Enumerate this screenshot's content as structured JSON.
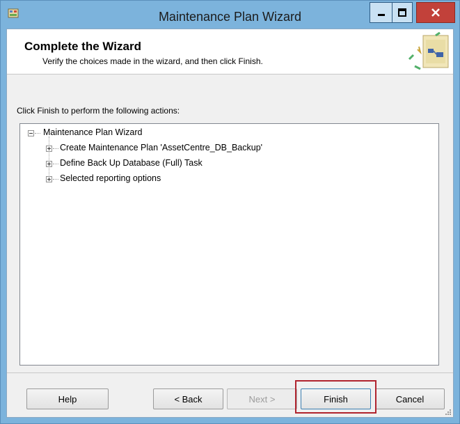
{
  "window": {
    "title": "Maintenance Plan Wizard",
    "icon": "wizard-app-icon",
    "controls": [
      "minimize-icon",
      "maximize-icon",
      "close-icon"
    ]
  },
  "header": {
    "title": "Complete the Wizard",
    "subtitle": "Verify the choices made in the wizard, and then click Finish.",
    "graphic": "wizard-graphic-icon"
  },
  "main": {
    "prompt": "Click Finish to perform the following actions:",
    "tree": {
      "root": {
        "label": "Maintenance Plan Wizard",
        "expanded": true
      },
      "children": [
        {
          "label": "Create Maintenance Plan 'AssetCentre_DB_Backup'",
          "expanded": false
        },
        {
          "label": "Define Back Up Database (Full) Task",
          "expanded": false
        },
        {
          "label": "Selected reporting options",
          "expanded": false
        }
      ]
    }
  },
  "buttons": {
    "help": "Help",
    "back": "< Back",
    "next": "Next >",
    "finish": "Finish",
    "cancel": "Cancel"
  },
  "colors": {
    "titlebar": "#7cb3dc",
    "close": "#c2413a",
    "highlight": "#b0232e"
  }
}
